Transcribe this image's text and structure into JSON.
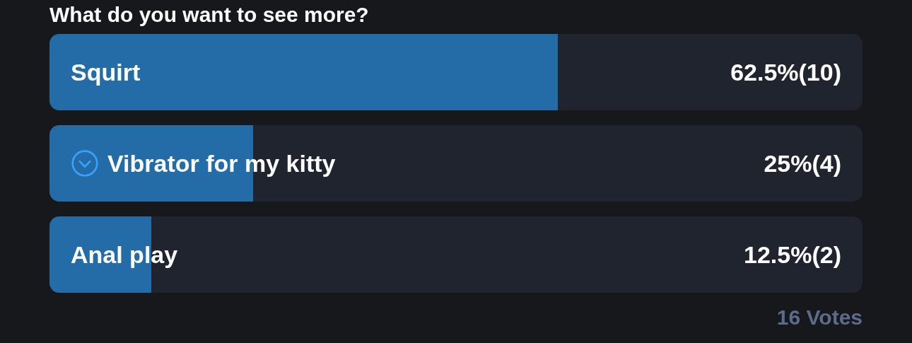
{
  "poll": {
    "question": "What do you want to see more?",
    "options": [
      {
        "label": "Squirt",
        "result": "62.5%(10)",
        "level": 0.625,
        "selected": false
      },
      {
        "label": "Vibrator for my kitty",
        "result": "25%(4)",
        "level": 0.25,
        "selected": true
      },
      {
        "label": "Anal play",
        "result": "12.5%(2)",
        "level": 0.125,
        "selected": false
      }
    ],
    "votes": "16 Votes"
  }
}
